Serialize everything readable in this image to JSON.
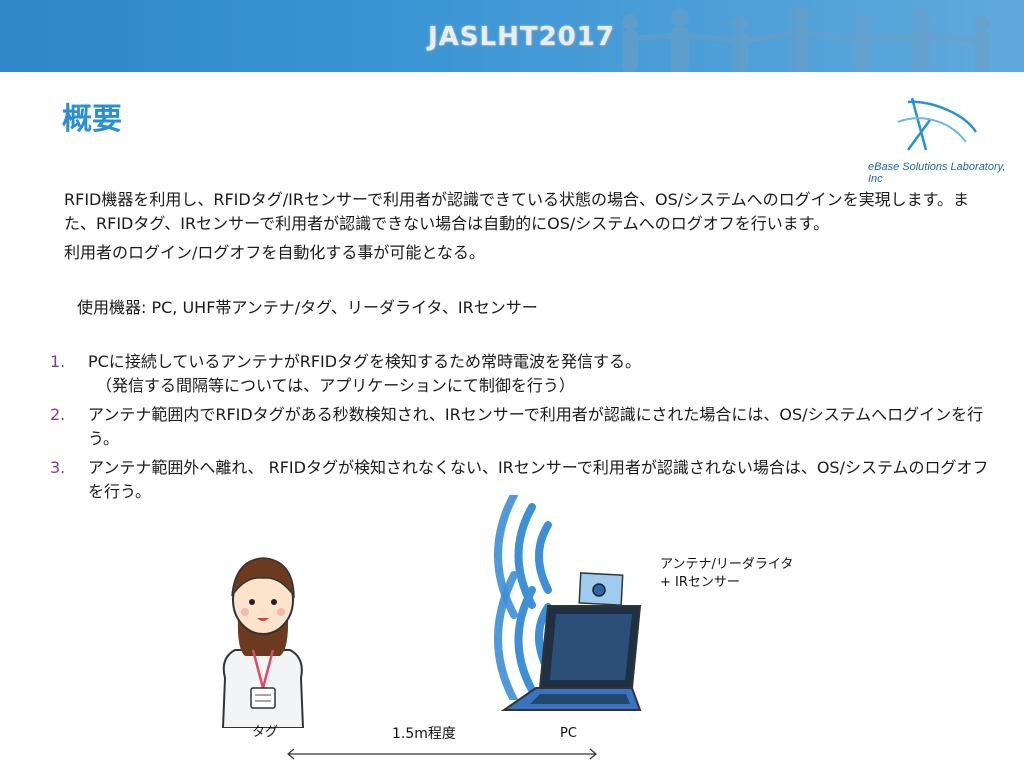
{
  "banner": {
    "title": "JASLHT2017"
  },
  "heading": "概要",
  "logo": {
    "text": "eBase Solutions Laboratory, Inc"
  },
  "intro": {
    "line1": "RFID機器を利用し、RFIDタグ/IRセンサーで利用者が認識できている状態の場合、OS/システムへのログインを実現します。また、RFIDタグ、IRセンサーで利用者が認識できない場合は自動的にOS/システムへのログオフを行います。",
    "line2": "利用者のログイン/ログオフを自動化する事が可能となる。",
    "equipment": "使用機器: PC, UHF帯アンテナ/タグ、リーダライタ、IRセンサー"
  },
  "steps": [
    {
      "num": "1.",
      "text": "PCに接続しているアンテナがRFIDタグを検知するため常時電波を発信する。",
      "sub": "（発信する間隔等については、アプリケーションにて制御を行う）"
    },
    {
      "num": "2.",
      "text": "アンテナ範囲内でRFIDタグがある秒数検知され、IRセンサーで利用者が認識にされた場合には、OS/システムへログインを行う。"
    },
    {
      "num": "3.",
      "text": "アンテナ範囲外へ離れ、 RFIDタグが検知されなくない、IRセンサーで利用者が認識されない場合は、OS/システムのログオフを行う。"
    }
  ],
  "illustration": {
    "antenna_label_line1": "アンテナ/リーダライタ",
    "antenna_label_line2": "+ IRセンサー",
    "tag_label": "タグ",
    "pc_label": "PC",
    "distance_label": "1.5m程度"
  }
}
